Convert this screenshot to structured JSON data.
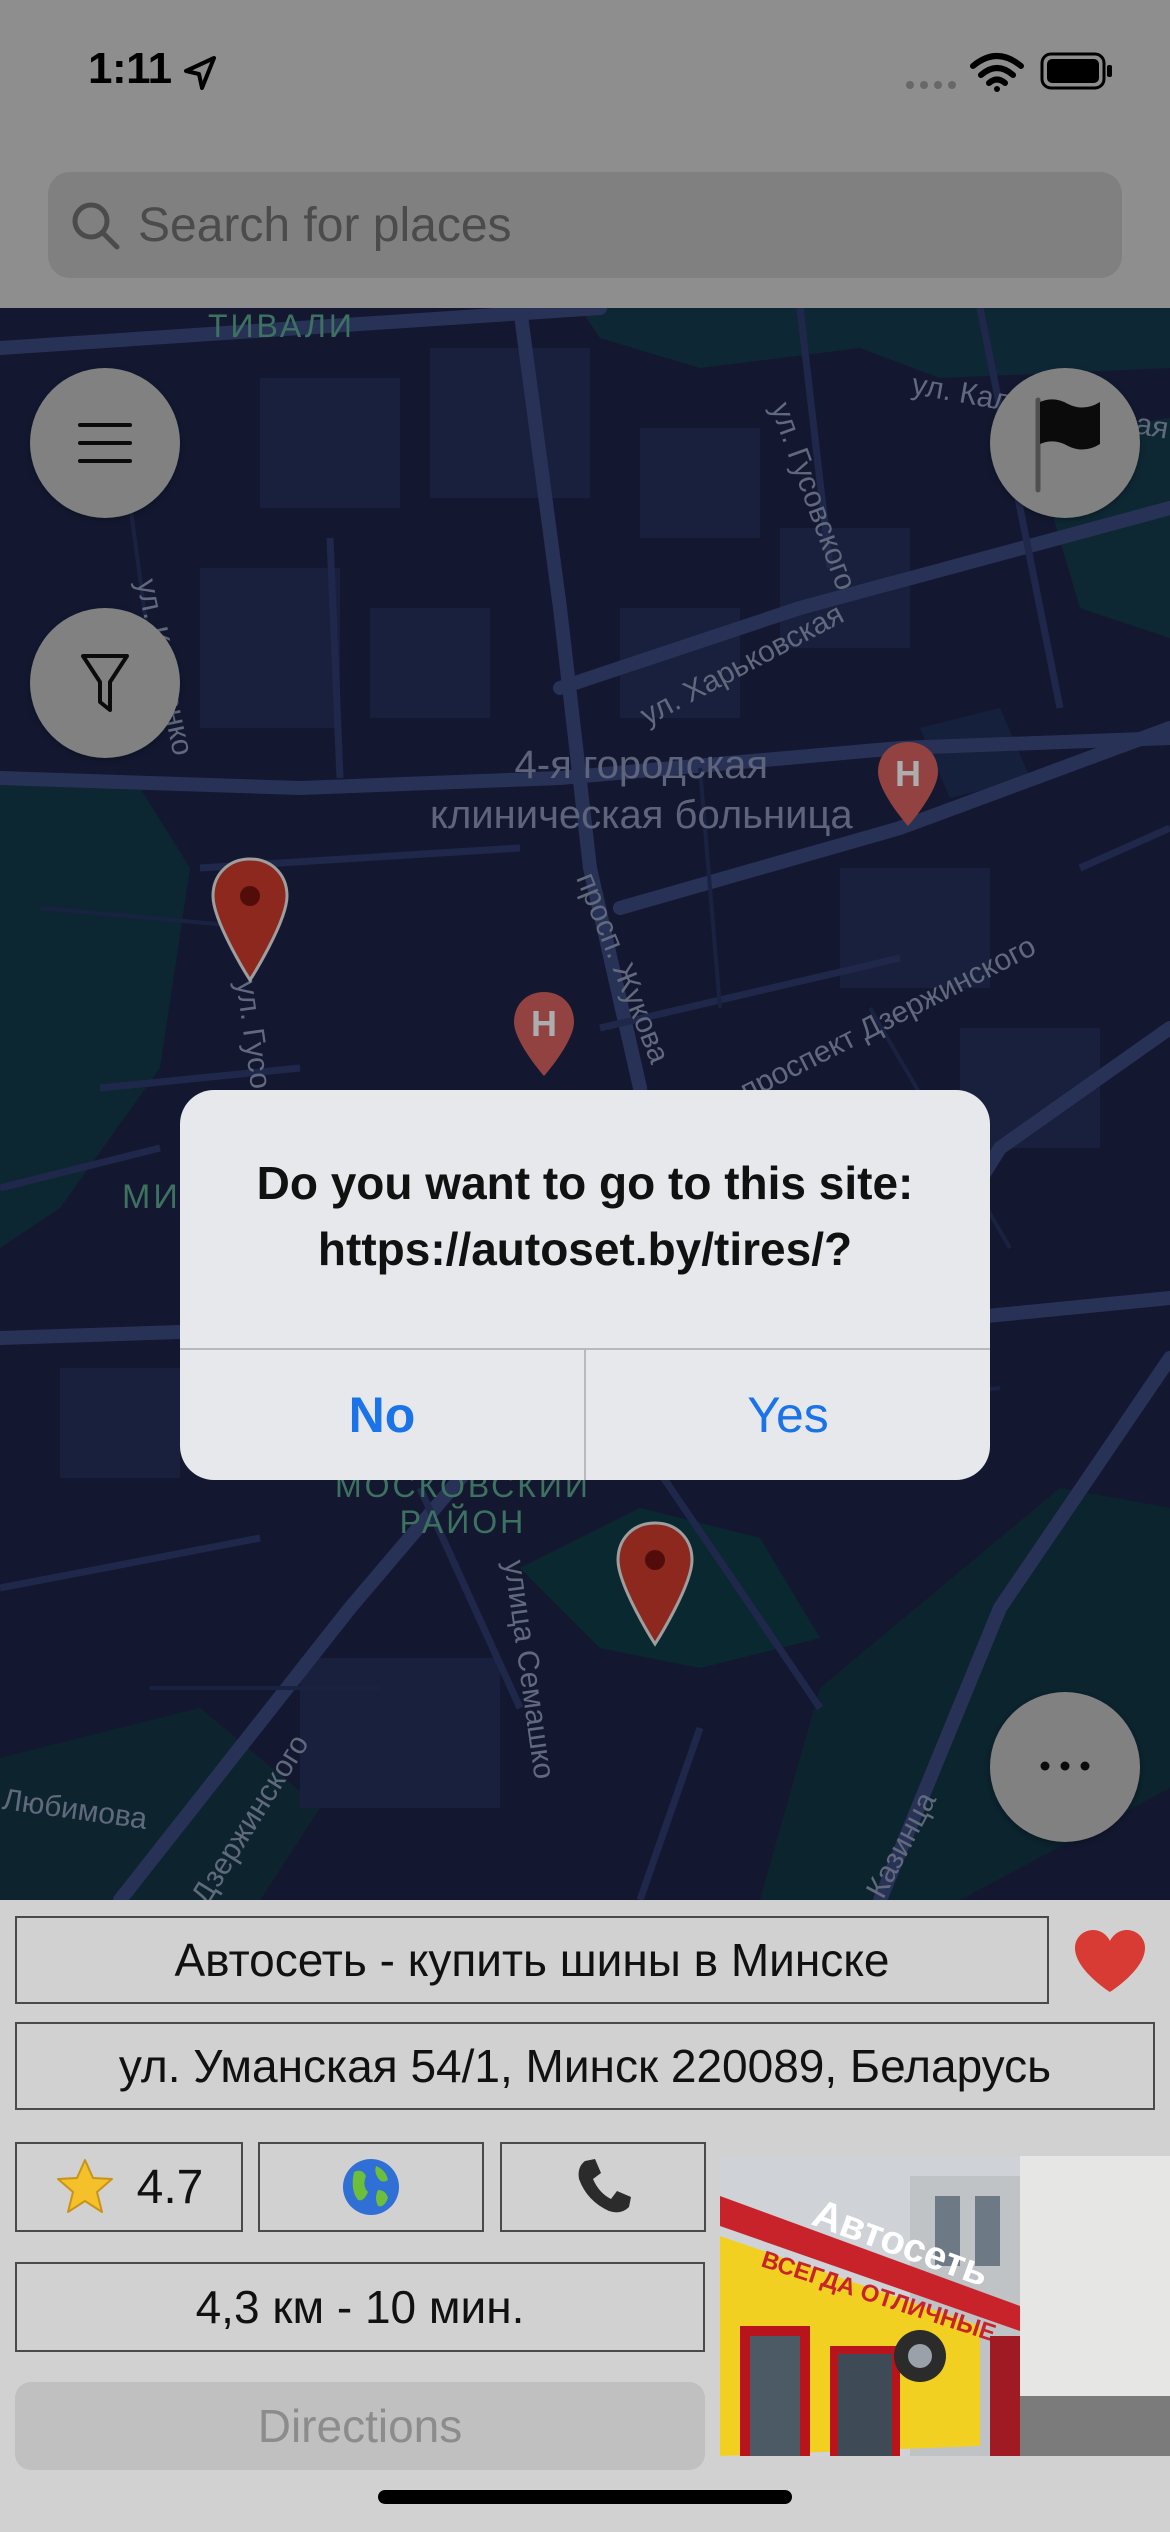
{
  "status_bar": {
    "time": "1:11"
  },
  "search": {
    "placeholder": "Search for places"
  },
  "map": {
    "labels": {
      "tivali": "ТИВАЛИ",
      "kalvar": "ул. Кальварийская",
      "gusovskogo": "ул. Гусовского",
      "kireenko": "ул. Киреенко",
      "kharkovskaya": "ул. Харьковская",
      "hospital": "4-я городская\nклиническая больница",
      "zhukova": "просп. Жукова",
      "dzerzh": "проспект Дзержинского",
      "gusov2": "ул. Гусо",
      "mi": "МИ",
      "moskovsky": "МОСКОВСКИЙ\nРАЙОН",
      "semashko": "улица Семашко",
      "lyubimova": "Любимова",
      "dzerzh2": "Дзержинского",
      "kazinca": "Казинца"
    }
  },
  "dialog": {
    "message": "Do you want to go to this site: https://autoset.by/tires/?",
    "no_label": "No",
    "yes_label": "Yes"
  },
  "place": {
    "name": "Автосеть - купить шины в Минске",
    "address": "ул. Уманская 54/1, Минск 220089, Беларусь",
    "rating": "4.7",
    "distance": "4,3 км - 10 мин.",
    "directions_label": "Directions",
    "photo_sign": "Автосеть",
    "photo_banner": "ВСЕГДА ОТЛИЧНЫЕ"
  },
  "colors": {
    "accent": "#1a73e8",
    "heart": "#d83a34",
    "map_bg": "#1c2448",
    "pin": "#d0372b"
  }
}
